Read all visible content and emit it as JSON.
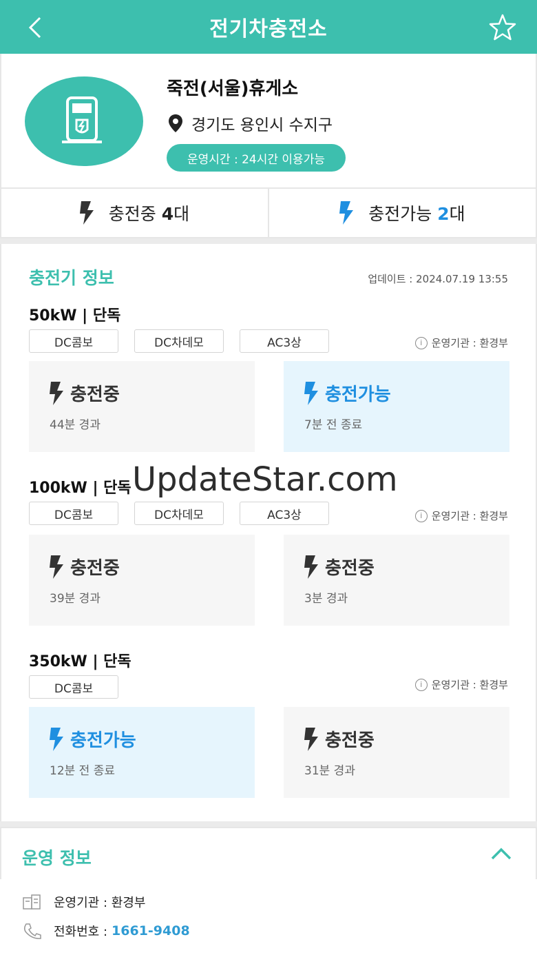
{
  "header": {
    "title": "전기차충전소"
  },
  "station": {
    "name": "죽전(서울)휴게소",
    "address": "경기도 용인시 수지구",
    "hours": "운영시간 : 24시간 이용가능"
  },
  "summary": {
    "charging_label": "충전중",
    "charging_count": "4",
    "charging_unit": "대",
    "available_label": "충전가능",
    "available_count": "2",
    "available_unit": "대"
  },
  "charger_info": {
    "title": "충전기 정보",
    "updated": "업데이트 : 2024.07.19 13:55",
    "groups": [
      {
        "title": "50kW  |  단독",
        "tags": [
          "DC콤보",
          "DC차데모",
          "AC3상"
        ],
        "operator": "운영기관 : 환경부",
        "slots": [
          {
            "status": "충전중",
            "detail": "44분 경과"
          },
          {
            "status": "충전가능",
            "detail": "7분 전 종료"
          }
        ]
      },
      {
        "title": "100kW  |  단독",
        "tags": [
          "DC콤보",
          "DC차데모",
          "AC3상"
        ],
        "operator": "운영기관 : 환경부",
        "slots": [
          {
            "status": "충전중",
            "detail": "39분 경과"
          },
          {
            "status": "충전중",
            "detail": "3분 경과"
          }
        ]
      },
      {
        "title": "350kW  |  단독",
        "tags": [
          "DC콤보"
        ],
        "operator": "운영기관 : 환경부",
        "slots": [
          {
            "status": "충전가능",
            "detail": "12분 전 종료"
          },
          {
            "status": "충전중",
            "detail": "31분 경과"
          }
        ]
      }
    ]
  },
  "operation": {
    "title": "운영 정보",
    "operator": "운영기관 : 환경부",
    "phone_label": "전화번호 :",
    "phone": "1661-9408"
  },
  "watermark": "UpdateStar.com",
  "colors": {
    "accent": "#3dbfae",
    "available_blue": "#1f8fe0",
    "phone_blue": "#2f9bd3"
  }
}
